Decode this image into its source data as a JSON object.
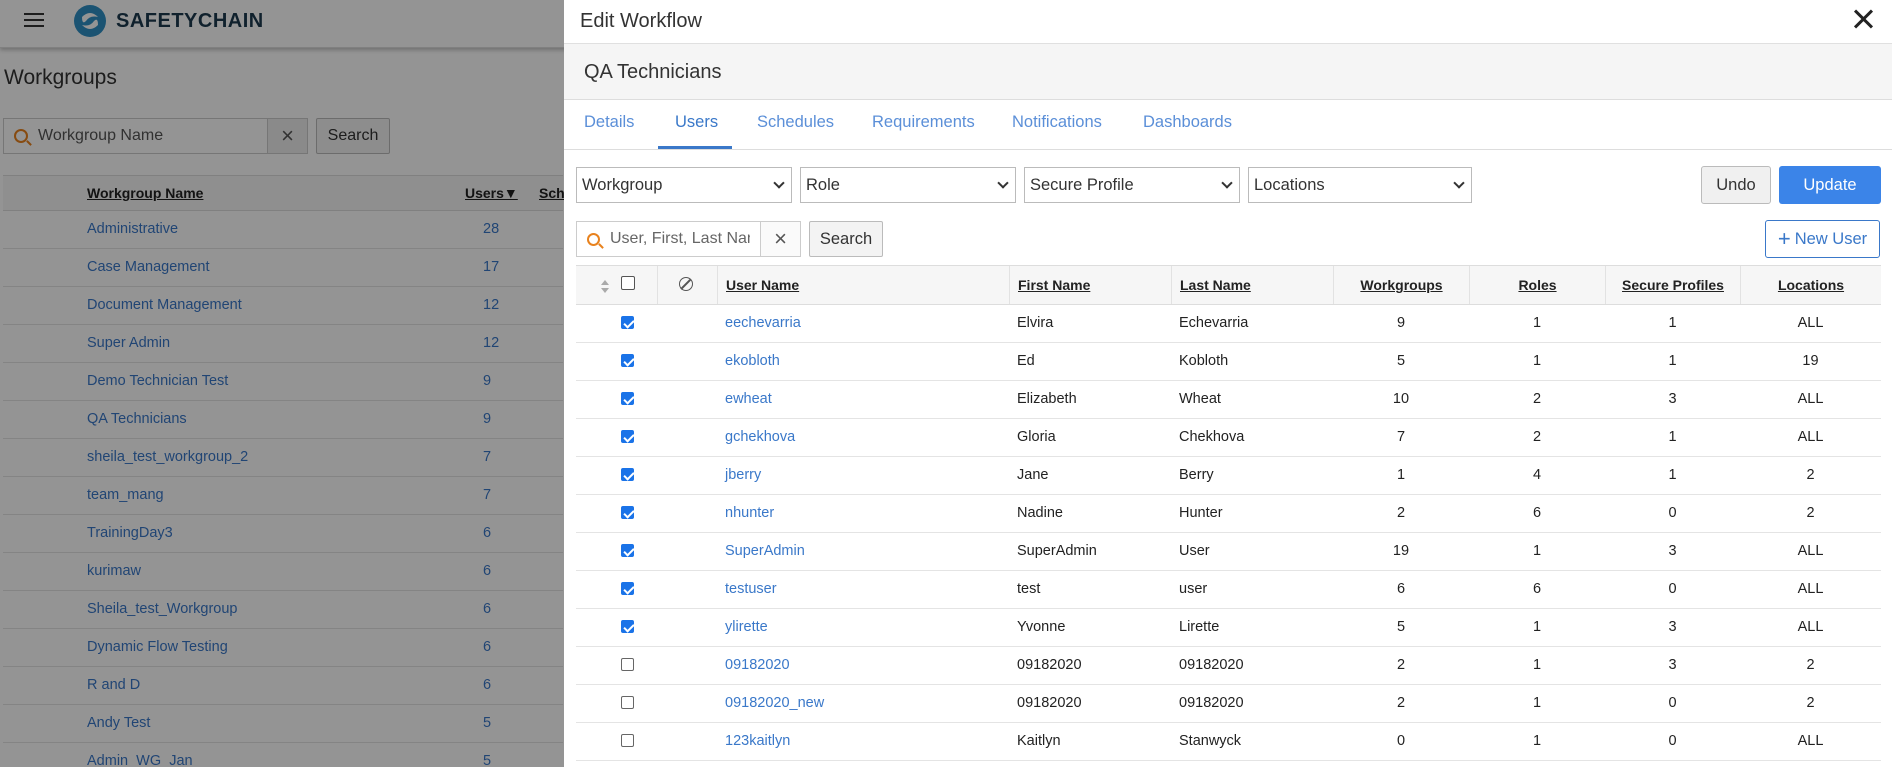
{
  "app": {
    "brand": "SAFETYCHAIN"
  },
  "background": {
    "page_title": "Workgroups",
    "search_placeholder": "Workgroup Name",
    "search_button": "Search",
    "columns": [
      "Workgroup Name",
      "Users▼",
      "Sche"
    ],
    "rows": [
      {
        "name": "Administrative",
        "users": "28"
      },
      {
        "name": "Case Management",
        "users": "17"
      },
      {
        "name": "Document Management",
        "users": "12"
      },
      {
        "name": "Super Admin",
        "users": "12"
      },
      {
        "name": "Demo Technician Test",
        "users": "9"
      },
      {
        "name": "QA Technicians",
        "users": "9"
      },
      {
        "name": "sheila_test_workgroup_2",
        "users": "7"
      },
      {
        "name": "team_mang",
        "users": "7"
      },
      {
        "name": "TrainingDay3",
        "users": "6"
      },
      {
        "name": "kurimaw",
        "users": "6"
      },
      {
        "name": "Sheila_test_Workgroup",
        "users": "6"
      },
      {
        "name": "Dynamic Flow Testing",
        "users": "6"
      },
      {
        "name": "R and D",
        "users": "6"
      },
      {
        "name": "Andy Test",
        "users": "5"
      },
      {
        "name": "Admin_WG_Jan",
        "users": "5"
      }
    ]
  },
  "dialog": {
    "title": "Edit Workflow",
    "subtitle": "QA Technicians",
    "tabs": [
      "Details",
      "Users",
      "Schedules",
      "Requirements",
      "Notifications",
      "Dashboards"
    ],
    "active_tab": "Users",
    "filters": {
      "workgroup": "Workgroup",
      "role": "Role",
      "secure_profile": "Secure Profile",
      "locations": "Locations"
    },
    "undo_label": "Undo",
    "update_label": "Update",
    "user_search_placeholder": "User, First, Last Name",
    "search_label": "Search",
    "new_user_label": "New User",
    "colors": {
      "accent": "#3b84e8",
      "link": "#3a78c9",
      "search_icon": "#e8821e"
    },
    "table": {
      "columns": {
        "user_name": "User Name",
        "first_name": "First Name",
        "last_name": "Last Name",
        "workgroups": "Workgroups",
        "roles": "Roles",
        "secure_profiles": "Secure Profiles",
        "locations": "Locations"
      },
      "rows": [
        {
          "checked": true,
          "user": "eechevarria",
          "first": "Elvira",
          "last": "Echevarria",
          "workgroups": "9",
          "roles": "1",
          "secure": "1",
          "locations": "ALL"
        },
        {
          "checked": true,
          "user": "ekobloth",
          "first": "Ed",
          "last": "Kobloth",
          "workgroups": "5",
          "roles": "1",
          "secure": "1",
          "locations": "19"
        },
        {
          "checked": true,
          "user": "ewheat",
          "first": "Elizabeth",
          "last": "Wheat",
          "workgroups": "10",
          "roles": "2",
          "secure": "3",
          "locations": "ALL"
        },
        {
          "checked": true,
          "user": "gchekhova",
          "first": "Gloria",
          "last": "Chekhova",
          "workgroups": "7",
          "roles": "2",
          "secure": "1",
          "locations": "ALL"
        },
        {
          "checked": true,
          "user": "jberry",
          "first": "Jane",
          "last": "Berry",
          "workgroups": "1",
          "roles": "4",
          "secure": "1",
          "locations": "2"
        },
        {
          "checked": true,
          "user": "nhunter",
          "first": "Nadine",
          "last": "Hunter",
          "workgroups": "2",
          "roles": "6",
          "secure": "0",
          "locations": "2"
        },
        {
          "checked": true,
          "user": "SuperAdmin",
          "first": "SuperAdmin",
          "last": "User",
          "workgroups": "19",
          "roles": "1",
          "secure": "3",
          "locations": "ALL"
        },
        {
          "checked": true,
          "user": "testuser",
          "first": "test",
          "last": "user",
          "workgroups": "6",
          "roles": "6",
          "secure": "0",
          "locations": "ALL"
        },
        {
          "checked": true,
          "user": "ylirette",
          "first": "Yvonne",
          "last": "Lirette",
          "workgroups": "5",
          "roles": "1",
          "secure": "3",
          "locations": "ALL"
        },
        {
          "checked": false,
          "user": "09182020",
          "first": "09182020",
          "last": "09182020",
          "workgroups": "2",
          "roles": "1",
          "secure": "3",
          "locations": "2"
        },
        {
          "checked": false,
          "user": "09182020_new",
          "first": "09182020",
          "last": "09182020",
          "workgroups": "2",
          "roles": "1",
          "secure": "0",
          "locations": "2"
        },
        {
          "checked": false,
          "user": "123kaitlyn",
          "first": "Kaitlyn",
          "last": "Stanwyck",
          "workgroups": "0",
          "roles": "1",
          "secure": "0",
          "locations": "ALL"
        }
      ]
    }
  }
}
